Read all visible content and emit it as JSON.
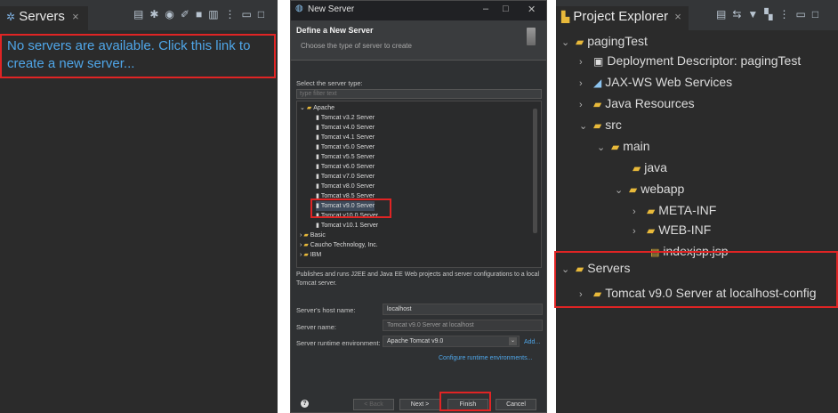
{
  "servers_view": {
    "tab_label": "Servers",
    "tab_close": "×",
    "empty_message": "No servers are available. Click this link to create a new server..."
  },
  "new_server_dialog": {
    "window_title": "New Server",
    "header_title": "Define a New Server",
    "header_subtitle": "Choose the type of server to create",
    "select_label": "Select the server type:",
    "filter_placeholder": "type filter text",
    "tree": {
      "apache_label": "Apache",
      "apache_items": [
        "Tomcat v3.2 Server",
        "Tomcat v4.0 Server",
        "Tomcat v4.1 Server",
        "Tomcat v5.0 Server",
        "Tomcat v5.5 Server",
        "Tomcat v6.0 Server",
        "Tomcat v7.0 Server",
        "Tomcat v8.0 Server",
        "Tomcat v8.5 Server",
        "Tomcat v9.0 Server",
        "Tomcat v10.0 Server",
        "Tomcat v10.1 Server"
      ],
      "selected_item": "Tomcat v9.0 Server",
      "other_groups": [
        "Basic",
        "Caucho Technology, Inc.",
        "IBM"
      ]
    },
    "description": "Publishes and runs J2EE and Java EE Web projects and server configurations to a local Tomcat server.",
    "host_label": "Server's host name:",
    "host_value": "localhost",
    "name_label": "Server name:",
    "name_value": "Tomcat v9.0 Server at localhost",
    "runtime_label": "Server runtime environment:",
    "runtime_value": "Apache Tomcat v9.0",
    "add_link": "Add...",
    "configure_link": "Configure runtime environments...",
    "buttons": {
      "help": "?",
      "back": "< Back",
      "next": "Next >",
      "finish": "Finish",
      "cancel": "Cancel"
    }
  },
  "project_explorer": {
    "tab_label": "Project Explorer",
    "tab_close": "×",
    "tree": {
      "project": "pagingTest",
      "deployment_descriptor": "Deployment Descriptor: pagingTest",
      "jaxws": "JAX-WS Web Services",
      "java_resources": "Java Resources",
      "src": "src",
      "main": "main",
      "java": "java",
      "webapp": "webapp",
      "meta_inf": "META-INF",
      "web_inf": "WEB-INF",
      "index_jsp": "indexjsp.jsp",
      "servers": "Servers",
      "tomcat_server": "Tomcat v9.0 Server at localhost-config"
    }
  },
  "colors": {
    "highlight_red": "#e02424",
    "link_blue": "#4fa6e8",
    "folder_yellow": "#e8b93a"
  }
}
